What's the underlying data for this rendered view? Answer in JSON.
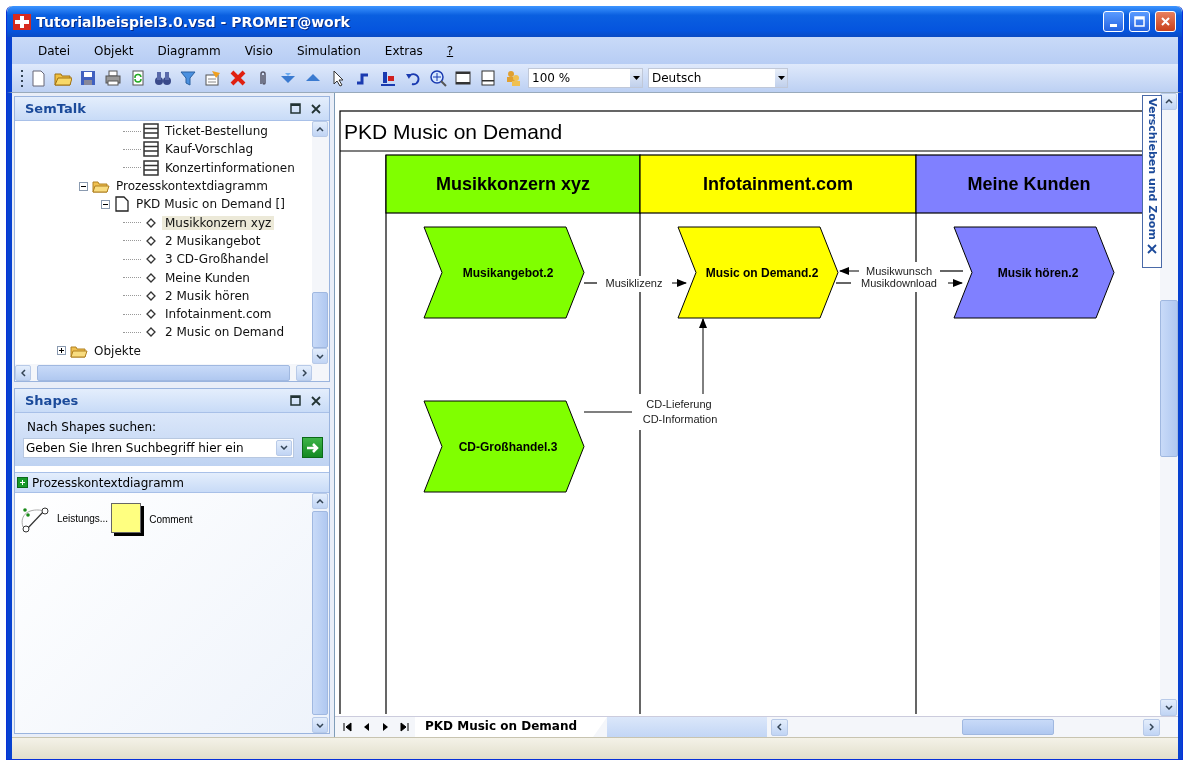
{
  "window": {
    "title": "Tutorialbeispiel3.0.vsd - PROMET@work"
  },
  "menu": [
    "Datei",
    "Objekt",
    "Diagramm",
    "Visio",
    "Simulation",
    "Extras",
    "?"
  ],
  "toolbar": {
    "zoom": "100 %",
    "language": "Deutsch"
  },
  "semtalk_panel": {
    "title": "SemTalk",
    "tree": [
      {
        "children": [
          {
            "children": [
              {
                "children": [
                  {
                    "label": "Ticket-Bestellung",
                    "kind": "table",
                    "selected": false
                  },
                  {
                    "label": "Kauf-Vorschlag",
                    "kind": "table",
                    "selected": false
                  },
                  {
                    "label": "Konzertinformationen",
                    "kind": "table",
                    "selected": false
                  }
                ]
              }
            ]
          },
          {
            "label": "Prozesskontextdiagramm",
            "kind": "folder",
            "expanded": true,
            "selected": false,
            "children": [
              {
                "label": "PKD Music on Demand []",
                "kind": "page",
                "expanded": true,
                "selected": false,
                "children": [
                  {
                    "label": "Musikkonzern xyz",
                    "kind": "object",
                    "selected": true
                  },
                  {
                    "label": "2 Musikangebot",
                    "kind": "object",
                    "selected": false
                  },
                  {
                    "label": "3 CD-Großhandel",
                    "kind": "object",
                    "selected": false
                  },
                  {
                    "label": "Meine Kunden",
                    "kind": "object",
                    "selected": false
                  },
                  {
                    "label": "2 Musik hören",
                    "kind": "object",
                    "selected": false
                  },
                  {
                    "label": "Infotainment.com",
                    "kind": "object",
                    "selected": false
                  },
                  {
                    "label": "2 Music on Demand",
                    "kind": "object",
                    "selected": false
                  }
                ]
              }
            ]
          }
        ]
      },
      {
        "label": "Objekte",
        "kind": "folder",
        "expanded": false,
        "selected": false
      }
    ]
  },
  "shapes_panel": {
    "title": "Shapes",
    "search_label": "Nach Shapes suchen:",
    "search": {
      "placeholder": "Geben Sie Ihren Suchbegriff hier ein"
    },
    "stencil": {
      "title": "Prozesskontextdiagramm",
      "items": [
        {
          "label": "Leistungs...",
          "kind": "connector"
        },
        {
          "label": "Comment",
          "kind": "note"
        }
      ]
    }
  },
  "diagram": {
    "title": "PKD Music on Demand",
    "lanes": [
      {
        "title": "Musikkonzern xyz",
        "color": "#80ff00",
        "steps": [
          "Musikangebot.2",
          "CD-Großhandel.3"
        ]
      },
      {
        "title": "Infotainment.com",
        "color": "#ffff00",
        "steps": [
          "Music on Demand.2"
        ]
      },
      {
        "title": "Meine Kunden",
        "color": "#8080ff",
        "steps": [
          "Musik hören.2"
        ]
      }
    ],
    "connectors": [
      {
        "labels": [
          "Musiklizenz"
        ]
      },
      {
        "labels": [
          "Musikwunsch"
        ]
      },
      {
        "labels": [
          "Musikdownload"
        ]
      },
      {
        "labels": [
          "CD-Lieferung",
          "CD-Information"
        ]
      }
    ]
  },
  "side_tab": {
    "label": "Verschieben und Zoom"
  },
  "page_tabs": [
    {
      "label": "PKD Music on Demand",
      "selected": true
    }
  ]
}
